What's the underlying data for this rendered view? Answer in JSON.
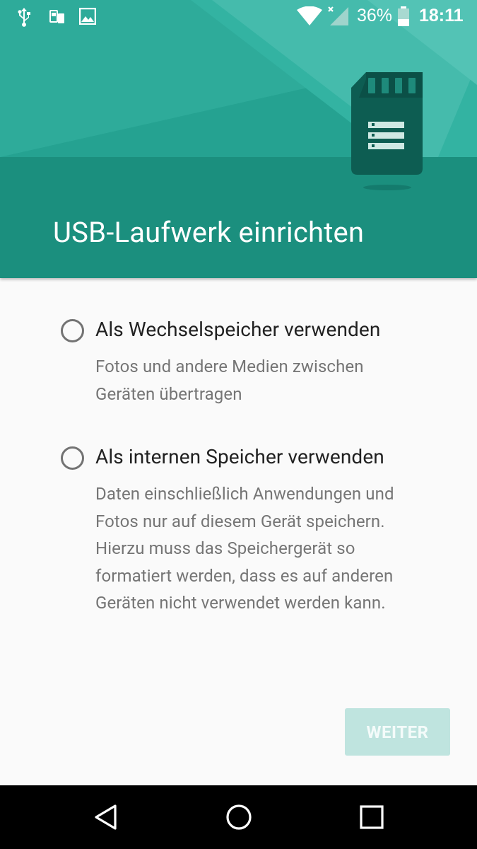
{
  "status_bar": {
    "battery_percent": "36%",
    "time": "18:11",
    "icons": [
      "usb-icon",
      "sim-icon",
      "image-icon",
      "wifi-icon",
      "cell-signal-icon",
      "battery-icon"
    ]
  },
  "header": {
    "title": "USB-Laufwerk einrichten",
    "illustration": "sd-card-icon"
  },
  "options": [
    {
      "label": "Als Wechselspeicher verwenden",
      "description": "Fotos und andere Medien zwischen\nGeräten übertragen",
      "selected": false
    },
    {
      "label": "Als internen Speicher verwenden",
      "description": "Daten einschließlich Anwendungen und\nFotos nur auf diesem Gerät speichern.\nHierzu muss das Speichergerät so\nformatiert werden, dass es auf anderen\nGeräten nicht verwendet werden kann.",
      "selected": false
    }
  ],
  "actions": {
    "next_label": "WEITER",
    "next_enabled": false
  },
  "nav_bar": {
    "buttons": [
      "back-icon",
      "home-icon",
      "recents-icon"
    ]
  },
  "colors": {
    "header": "#1c8e7d",
    "header_light": "#3fafa0",
    "background": "#fafafa",
    "title_text": "#212121",
    "secondary_text": "#757575",
    "button_disabled": "#bfe4df"
  }
}
